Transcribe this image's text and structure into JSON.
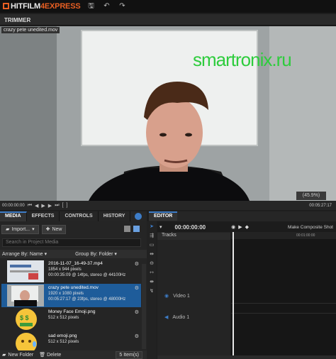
{
  "app": {
    "brand_left": "HITFILM",
    "brand_num": "4",
    "brand_right": "EXPRESS",
    "accent_color": "#e85f23",
    "selection_color": "#1e5c9a"
  },
  "titlebar": {
    "icons": [
      "save-icon",
      "undo-icon",
      "redo-icon"
    ],
    "save_glyph": "🖫",
    "undo_glyph": "↶",
    "redo_glyph": "↷"
  },
  "trimmer": {
    "panel_title": "TRIMMER",
    "clip_name": "crazy pete unedited.mov",
    "zoom": "(45.9%)",
    "time_left": "00:00:00:00",
    "time_right": "00:05:27:17"
  },
  "watermark": "smartronix.ru",
  "left_tabs": [
    "MEDIA",
    "EFFECTS",
    "CONTROLS",
    "HISTORY"
  ],
  "media": {
    "import_label": "Import...",
    "new_label": "New",
    "search_placeholder": "Search in Project Media",
    "arrange_label": "Arrange By: Name",
    "group_label": "Group By: Folder",
    "items": [
      {
        "name": "2016-11-07_16-49-37.mp4",
        "line2": "1854 x 944 pixels",
        "line3": "00:00:35:09 @ 14fps, stereo @ 44100Hz"
      },
      {
        "name": "crazy pete unedited.mov",
        "line2": "1920 x 1080 pixels",
        "line3": "00:05:27:17 @ 23fps, stereo @ 48000Hz"
      },
      {
        "name": "Money Face Emoji.png",
        "line2": "512 x 512 pixels",
        "line3": ""
      },
      {
        "name": "sad emoji.png",
        "line2": "512 x 512 pixels",
        "line3": ""
      }
    ],
    "footer_new_folder": "New Folder",
    "footer_delete": "Delete",
    "items_count": "5 Item(s)"
  },
  "editor": {
    "tab": "EDITOR",
    "time": "00:00:00:00",
    "make_composite": "Make Composite Shot",
    "tracks_label": "Tracks",
    "video_track": "Video 1",
    "audio_track": "Audio 1",
    "ruler_time": "00:01:00:00"
  }
}
